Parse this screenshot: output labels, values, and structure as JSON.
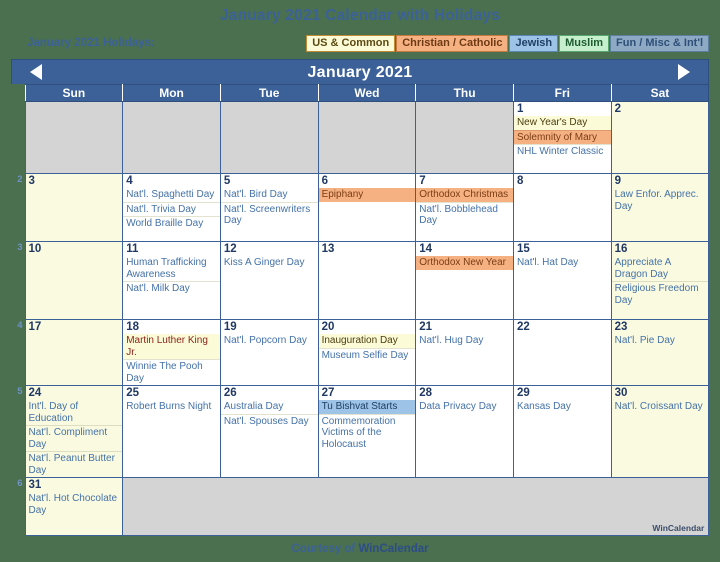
{
  "title": "January 2021 Calendar with Holidays",
  "legend": {
    "label": "January 2021 Holidays:",
    "badges": [
      {
        "key": "us",
        "label": "US & Common"
      },
      {
        "key": "chr",
        "label": "Christian / Catholic"
      },
      {
        "key": "jew",
        "label": "Jewish"
      },
      {
        "key": "mus",
        "label": "Muslim"
      },
      {
        "key": "fun",
        "label": "Fun / Misc & Int'l"
      }
    ]
  },
  "colors": {
    "page_background": "#4a7050",
    "header_blue": "#3b6198",
    "title_text": "#3b6198",
    "weekend_cell": "#fafae1",
    "weekday_cell": "#ffffff",
    "blank_cell": "#d4d4d4",
    "us_common": "#fcfbd8",
    "christian": "#f6b183",
    "jewish": "#9dc3e6",
    "muslim": "#c6efcd",
    "fun_misc": "#8ea9c4",
    "event_text": "#4472a8",
    "day_number": "#1f3864"
  },
  "month_bar": {
    "month_label": "January 2021",
    "prev_icon": "triangle-left-icon",
    "next_icon": "triangle-right-icon"
  },
  "weekdays": [
    "Sun",
    "Mon",
    "Tue",
    "Wed",
    "Thu",
    "Fri",
    "Sat"
  ],
  "week_numbers": [
    "",
    "2",
    "3",
    "4",
    "5",
    "6"
  ],
  "watermark": "WinCalendar",
  "footer": {
    "prefix": "Courtesy of ",
    "brand": "WinCalendar"
  },
  "weeks": [
    {
      "number": "",
      "days": [
        {
          "num": "",
          "blank": true,
          "weekend": true,
          "events": []
        },
        {
          "num": "",
          "blank": true,
          "weekend": false,
          "events": []
        },
        {
          "num": "",
          "blank": true,
          "weekend": false,
          "events": []
        },
        {
          "num": "",
          "blank": true,
          "weekend": false,
          "events": []
        },
        {
          "num": "",
          "blank": true,
          "weekend": false,
          "events": []
        },
        {
          "num": "1",
          "blank": false,
          "weekend": false,
          "events": [
            {
              "label": "New Year's Day",
              "type": "us"
            },
            {
              "label": "Solemnity of Mary",
              "type": "chr"
            },
            {
              "label": "NHL Winter Classic",
              "type": "fun"
            }
          ]
        },
        {
          "num": "2",
          "blank": false,
          "weekend": true,
          "events": []
        }
      ]
    },
    {
      "number": "2",
      "days": [
        {
          "num": "3",
          "blank": false,
          "weekend": true,
          "events": []
        },
        {
          "num": "4",
          "blank": false,
          "weekend": false,
          "events": [
            {
              "label": "Nat'l. Spaghetti Day",
              "type": "fun"
            },
            {
              "label": "Nat'l. Trivia Day",
              "type": "fun"
            },
            {
              "label": "World Braille Day",
              "type": "fun"
            }
          ]
        },
        {
          "num": "5",
          "blank": false,
          "weekend": false,
          "events": [
            {
              "label": "Nat'l. Bird Day",
              "type": "fun"
            },
            {
              "label": "Nat'l. Screenwriters Day",
              "type": "fun"
            }
          ]
        },
        {
          "num": "6",
          "blank": false,
          "weekend": false,
          "events": [
            {
              "label": "Epiphany",
              "type": "chr"
            }
          ]
        },
        {
          "num": "7",
          "blank": false,
          "weekend": false,
          "events": [
            {
              "label": "Orthodox Christmas",
              "type": "chr"
            },
            {
              "label": "Nat'l. Bobblehead Day",
              "type": "fun"
            }
          ]
        },
        {
          "num": "8",
          "blank": false,
          "weekend": false,
          "events": []
        },
        {
          "num": "9",
          "blank": false,
          "weekend": true,
          "events": [
            {
              "label": "Law Enfor. Apprec. Day",
              "type": "fun"
            }
          ]
        }
      ]
    },
    {
      "number": "3",
      "days": [
        {
          "num": "10",
          "blank": false,
          "weekend": true,
          "events": []
        },
        {
          "num": "11",
          "blank": false,
          "weekend": false,
          "events": [
            {
              "label": "Human Trafficking Awareness",
              "type": "fun"
            },
            {
              "label": "Nat'l. Milk Day",
              "type": "fun"
            }
          ]
        },
        {
          "num": "12",
          "blank": false,
          "weekend": false,
          "events": [
            {
              "label": "Kiss A Ginger Day",
              "type": "fun"
            }
          ]
        },
        {
          "num": "13",
          "blank": false,
          "weekend": false,
          "events": []
        },
        {
          "num": "14",
          "blank": false,
          "weekend": false,
          "events": [
            {
              "label": "Orthodox New Year",
              "type": "chr"
            }
          ]
        },
        {
          "num": "15",
          "blank": false,
          "weekend": false,
          "events": [
            {
              "label": "Nat'l. Hat Day",
              "type": "fun"
            }
          ]
        },
        {
          "num": "16",
          "blank": false,
          "weekend": true,
          "events": [
            {
              "label": "Appreciate A Dragon Day",
              "type": "fun"
            },
            {
              "label": "Religious Freedom Day",
              "type": "fun"
            }
          ]
        }
      ]
    },
    {
      "number": "4",
      "days": [
        {
          "num": "17",
          "blank": false,
          "weekend": true,
          "events": []
        },
        {
          "num": "18",
          "blank": false,
          "weekend": false,
          "events": [
            {
              "label": "Martin Luther King Jr.",
              "type": "fed"
            },
            {
              "label": "Winnie The Pooh Day",
              "type": "fun"
            }
          ]
        },
        {
          "num": "19",
          "blank": false,
          "weekend": false,
          "events": [
            {
              "label": "Nat'l. Popcorn Day",
              "type": "fun"
            }
          ]
        },
        {
          "num": "20",
          "blank": false,
          "weekend": false,
          "events": [
            {
              "label": "Inauguration Day",
              "type": "us"
            },
            {
              "label": "Museum Selfie Day",
              "type": "fun"
            }
          ]
        },
        {
          "num": "21",
          "blank": false,
          "weekend": false,
          "events": [
            {
              "label": "Nat'l. Hug Day",
              "type": "fun"
            }
          ]
        },
        {
          "num": "22",
          "blank": false,
          "weekend": false,
          "events": []
        },
        {
          "num": "23",
          "blank": false,
          "weekend": true,
          "events": [
            {
              "label": "Nat'l. Pie Day",
              "type": "fun"
            }
          ]
        }
      ]
    },
    {
      "number": "5",
      "days": [
        {
          "num": "24",
          "blank": false,
          "weekend": true,
          "events": [
            {
              "label": "Int'l. Day of Education",
              "type": "fun"
            },
            {
              "label": "Nat'l. Compliment Day",
              "type": "fun"
            },
            {
              "label": "Nat'l. Peanut Butter Day",
              "type": "fun"
            }
          ]
        },
        {
          "num": "25",
          "blank": false,
          "weekend": false,
          "events": [
            {
              "label": "Robert Burns Night",
              "type": "fun"
            }
          ]
        },
        {
          "num": "26",
          "blank": false,
          "weekend": false,
          "events": [
            {
              "label": "Australia Day",
              "type": "fun"
            },
            {
              "label": "Nat'l. Spouses Day",
              "type": "fun"
            }
          ]
        },
        {
          "num": "27",
          "blank": false,
          "weekend": false,
          "events": [
            {
              "label": "Tu Bishvat Starts",
              "type": "jew"
            },
            {
              "label": "Commemoration Victims of the Holocaust",
              "type": "fun"
            }
          ]
        },
        {
          "num": "28",
          "blank": false,
          "weekend": false,
          "events": [
            {
              "label": "Data Privacy Day",
              "type": "fun"
            }
          ]
        },
        {
          "num": "29",
          "blank": false,
          "weekend": false,
          "events": [
            {
              "label": "Kansas Day",
              "type": "fun"
            }
          ]
        },
        {
          "num": "30",
          "blank": false,
          "weekend": true,
          "events": [
            {
              "label": "Nat'l. Croissant Day",
              "type": "fun"
            }
          ]
        }
      ]
    },
    {
      "number": "6",
      "days": [
        {
          "num": "31",
          "blank": false,
          "weekend": true,
          "events": [
            {
              "label": "Nat'l. Hot Chocolate Day",
              "type": "fun"
            }
          ]
        },
        {
          "num": "",
          "blank": true,
          "filler": true,
          "weekend": false,
          "events": []
        }
      ]
    }
  ]
}
